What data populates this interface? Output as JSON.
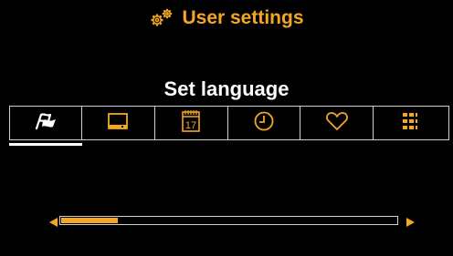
{
  "header": {
    "title": "User settings",
    "icon": "gears-icon",
    "accent_color": "#f5a623"
  },
  "main": {
    "subtitle": "Set language",
    "tabs": [
      {
        "icon": "language-flags-icon",
        "selected": true
      },
      {
        "icon": "display-icon",
        "selected": false
      },
      {
        "icon": "calendar-icon",
        "calendar_day": "17",
        "selected": false
      },
      {
        "icon": "clock-icon",
        "selected": false
      },
      {
        "icon": "heart-icon",
        "selected": false
      },
      {
        "icon": "grid-menu-icon",
        "selected": false
      }
    ]
  },
  "scrollbar": {
    "position_fraction": 0.17
  }
}
